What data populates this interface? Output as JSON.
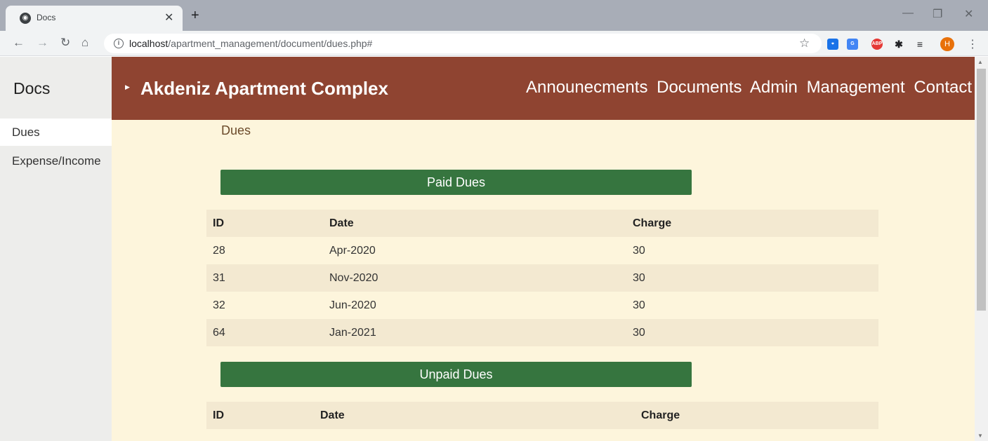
{
  "browser": {
    "tab_title": "Docs",
    "url_host": "localhost",
    "url_path": "/apartment_management/document/dues.php#"
  },
  "sidebar": {
    "title": "Docs",
    "items": [
      {
        "label": "Dues"
      },
      {
        "label": "Expense/Income"
      }
    ]
  },
  "header": {
    "brand": "Akdeniz Apartment Complex",
    "nav": [
      "Announecments",
      "Documents",
      "Admin",
      "Management",
      "Contact"
    ]
  },
  "breadcrumb": "Dues",
  "paid": {
    "title": "Paid Dues",
    "columns": [
      "ID",
      "Date",
      "Charge"
    ],
    "rows": [
      [
        "28",
        "Apr-2020",
        "30"
      ],
      [
        "31",
        "Nov-2020",
        "30"
      ],
      [
        "32",
        "Jun-2020",
        "30"
      ],
      [
        "64",
        "Jan-2021",
        "30"
      ]
    ]
  },
  "unpaid": {
    "title": "Unpaid Dues",
    "columns": [
      "ID",
      "Date",
      "Charge"
    ]
  },
  "colors": {
    "header": "#8f4431",
    "section_bar": "#36753f",
    "page_bg": "#fdf5dc",
    "row_shade": "#f3e9d1"
  }
}
